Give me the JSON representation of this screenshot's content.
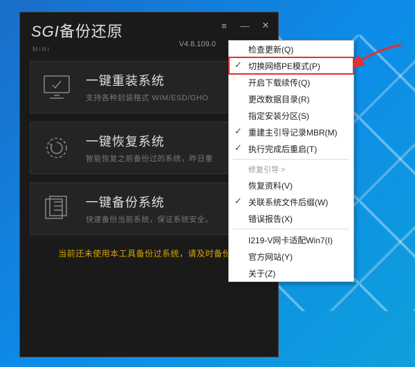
{
  "window": {
    "logo_roman": "SGI",
    "logo_chinese": "备份还原",
    "mini": "MiNi",
    "version": "V4.8.109.0"
  },
  "cards": [
    {
      "title": "一键重装系统",
      "desc": "支持各种封装格式 WIM/ESD/GHO"
    },
    {
      "title": "一键恢复系统",
      "desc": "智能恢复之前备份过的系统，昨日重"
    },
    {
      "title": "一键备份系统",
      "desc": "快速备份当前系统，保证系统安全。"
    }
  ],
  "footer": "当前还未使用本工具备份过系统，请及时备份！",
  "menu": {
    "items": [
      {
        "label": "检查更新(Q)",
        "checked": false
      },
      {
        "label": "切换网络PE模式(P)",
        "checked": true,
        "highlight": true
      },
      {
        "label": "开启下载续传(Q)",
        "checked": false
      },
      {
        "label": "更改数据目录(R)",
        "checked": false
      },
      {
        "label": "指定安装分区(S)",
        "checked": false
      },
      {
        "label": "重建主引导记录MBR(M)",
        "checked": true
      },
      {
        "label": "执行完成后重启(T)",
        "checked": true
      }
    ],
    "section_header": "修复引导 >",
    "items2": [
      {
        "label": "恢复资料(V)",
        "checked": false
      },
      {
        "label": "关联系统文件后缀(W)",
        "checked": true
      },
      {
        "label": "错误报告(X)",
        "checked": false
      }
    ],
    "items3": [
      {
        "label": "I219-V网卡适配Win7(I)",
        "checked": false
      },
      {
        "label": "官方网站(Y)",
        "checked": false
      },
      {
        "label": "关于(Z)",
        "checked": false
      }
    ]
  }
}
